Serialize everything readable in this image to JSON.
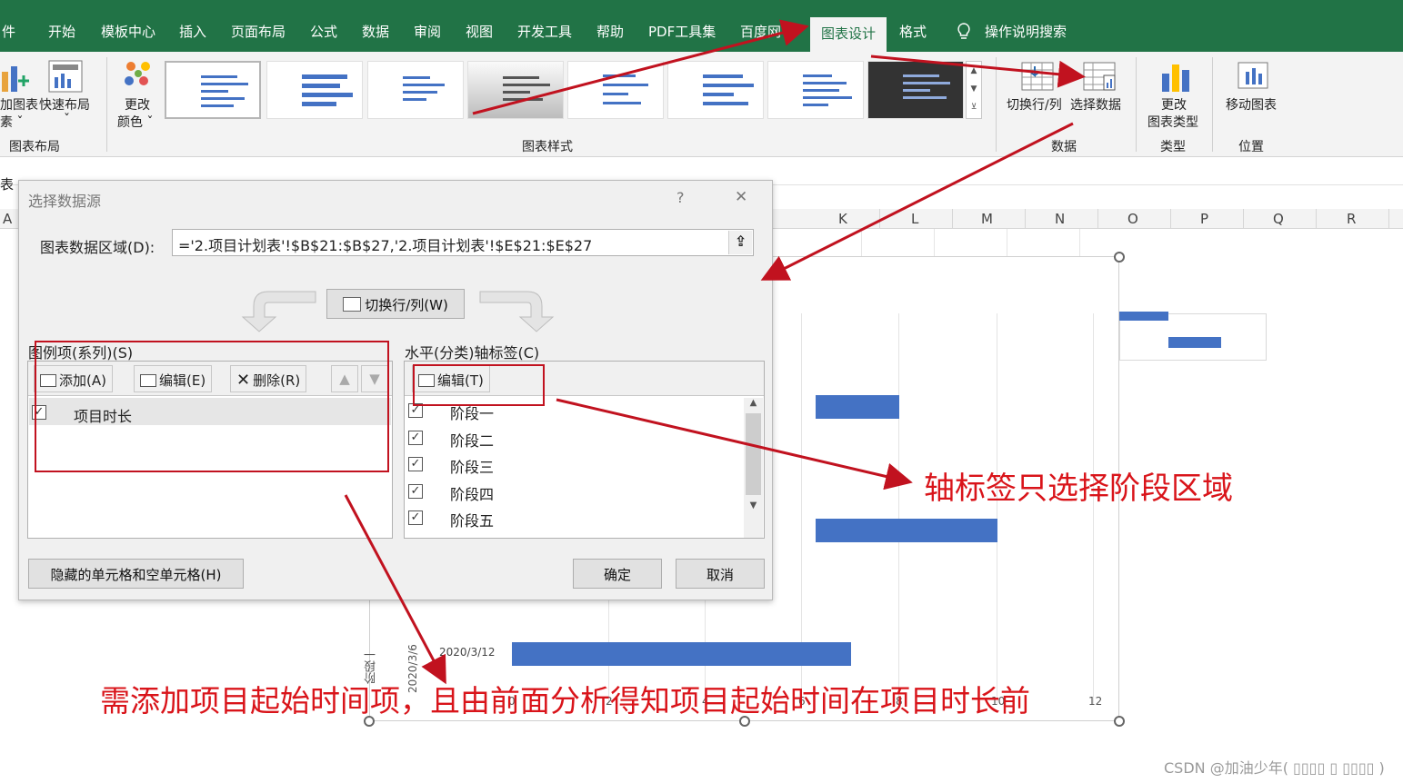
{
  "ribbon_tabs": [
    {
      "label": "件",
      "active": false
    },
    {
      "label": "开始",
      "active": false
    },
    {
      "label": "模板中心",
      "active": false
    },
    {
      "label": "插入",
      "active": false
    },
    {
      "label": "页面布局",
      "active": false
    },
    {
      "label": "公式",
      "active": false
    },
    {
      "label": "数据",
      "active": false
    },
    {
      "label": "审阅",
      "active": false
    },
    {
      "label": "视图",
      "active": false
    },
    {
      "label": "开发工具",
      "active": false
    },
    {
      "label": "帮助",
      "active": false
    },
    {
      "label": "PDF工具集",
      "active": false
    },
    {
      "label": "百度网",
      "active": false
    },
    {
      "label": "图表设计",
      "active": true
    },
    {
      "label": "格式",
      "active": false
    }
  ],
  "search_label": "操作说明搜索",
  "ribbon": {
    "add_element_line1": "加图表",
    "add_element_line2": "素 ˇ",
    "quick_layout": "快速布局",
    "quick_layout_caret": "ˇ",
    "change_color_line1": "更改",
    "change_color_line2": "颜色 ˇ",
    "group_layout": "图表布局",
    "group_styles": "图表样式",
    "switch_row_col": "切换行/列",
    "select_data": "选择数据",
    "group_data": "数据",
    "change_type_line1": "更改",
    "change_type_line2": "图表类型",
    "group_type": "类型",
    "move_chart": "移动图表",
    "group_location": "位置"
  },
  "name_box": "表",
  "columns": [
    "K",
    "L",
    "M",
    "N",
    "O",
    "P",
    "Q",
    "R"
  ],
  "row_hdr_a": "A",
  "dialog": {
    "title": "选择数据源",
    "help": "?",
    "close": "✕",
    "range_label": "图表数据区域(D):",
    "range_value": "='2.项目计划表'!$B$21:$B$27,'2.项目计划表'!$E$21:$E$27",
    "switch_button": "切换行/列(W)",
    "legend_label": "图例项(系列)(S)",
    "add": "添加(A)",
    "edit": "编辑(E)",
    "delete": "删除(R)",
    "series": [
      {
        "name": "项目时长",
        "checked": true
      }
    ],
    "axis_label": "水平(分类)轴标签(C)",
    "axis_edit": "编辑(T)",
    "categories": [
      "阶段一",
      "阶段二",
      "阶段三",
      "阶段四",
      "阶段五"
    ],
    "hidden_cells": "隐藏的单元格和空单元格(H)",
    "ok": "确定",
    "cancel": "取消"
  },
  "chart": {
    "category_label": "阶段一",
    "date_label": "2020/3/6",
    "start_label": "2020/3/12",
    "x_ticks": [
      "0",
      "2",
      "4",
      "6",
      "8",
      "10",
      "12"
    ]
  },
  "annotations": {
    "axis_note": "轴标签只选择阶段区域",
    "bottom_note": "需添加项目起始时间项，且由前面分析得知项目起始时间在项目时长前"
  },
  "watermark": "CSDN @加油少年( ▯▯▯▯ ▯ ▯▯▯▯ )",
  "colors": {
    "excel_green": "#217346",
    "bar_blue": "#4472c4",
    "annotation_red": "#c1121f"
  }
}
